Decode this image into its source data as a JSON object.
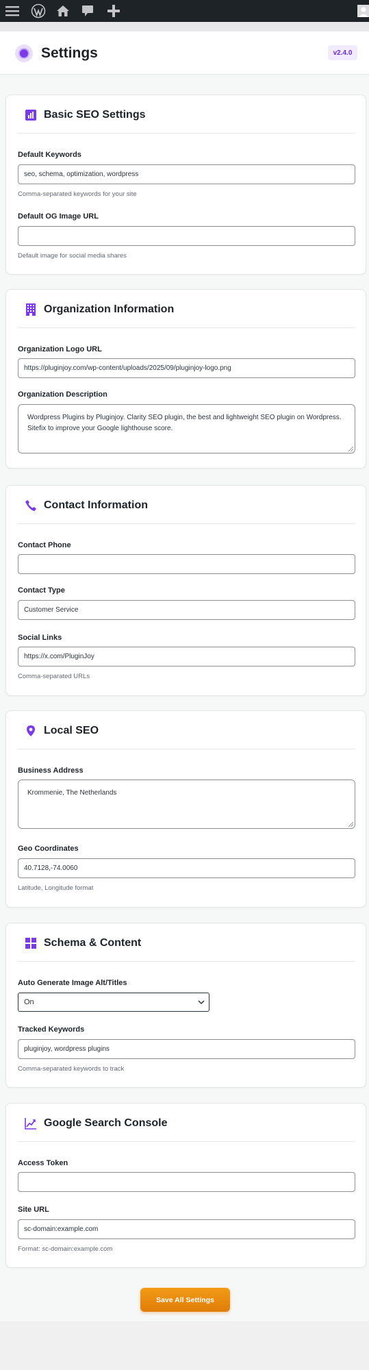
{
  "colors": {
    "accent": "#7c3aed",
    "admin_bar": "#1d2327",
    "save_button": "#ef8c11"
  },
  "admin_bar": {
    "icons": [
      "menu-icon",
      "wordpress-icon",
      "home-icon",
      "comments-icon",
      "plus-icon",
      "avatar"
    ]
  },
  "header": {
    "title": "Settings",
    "version": "v2.4.0"
  },
  "sections": {
    "basic": {
      "title": "Basic SEO Settings",
      "default_keywords": {
        "label": "Default Keywords",
        "value": "seo, schema, optimization, wordpress",
        "help": "Comma-separated keywords for your site"
      },
      "og_image": {
        "label": "Default OG Image URL",
        "value": "",
        "help": "Default image for social media shares"
      }
    },
    "organization": {
      "title": "Organization Information",
      "logo_url": {
        "label": "Organization Logo URL",
        "value": "https://pluginjoy.com/wp-content/uploads/2025/09/pluginjoy-logo.png"
      },
      "description": {
        "label": "Organization Description",
        "value": "Wordpress Plugins by Pluginjoy. Clarity SEO plugin, the best and lightweight SEO plugin on Wordpress. Sitefix to improve your Google lighthouse score."
      }
    },
    "contact": {
      "title": "Contact Information",
      "phone": {
        "label": "Contact Phone",
        "value": ""
      },
      "type": {
        "label": "Contact Type",
        "value": "Customer Service"
      },
      "social": {
        "label": "Social Links",
        "value": "https://x.com/PluginJoy",
        "help": "Comma-separated URLs"
      }
    },
    "local": {
      "title": "Local SEO",
      "address": {
        "label": "Business Address",
        "value": "Krommenie, The Netherlands"
      },
      "geo": {
        "label": "Geo Coordinates",
        "value": "40.7128,-74.0060",
        "help": "Latitude, Longitude format"
      }
    },
    "schema": {
      "title": "Schema & Content",
      "auto_alt": {
        "label": "Auto Generate Image Alt/Titles",
        "value": "On"
      },
      "tracked": {
        "label": "Tracked Keywords",
        "value": "pluginjoy, wordpress plugins",
        "help": "Comma-separated keywords to track"
      }
    },
    "gsc": {
      "title": "Google Search Console",
      "token": {
        "label": "Access Token",
        "value": ""
      },
      "site_url": {
        "label": "Site URL",
        "value": "sc-domain:example.com",
        "help": "Format: sc-domain:example.com"
      }
    }
  },
  "save_button": "Save All Settings"
}
